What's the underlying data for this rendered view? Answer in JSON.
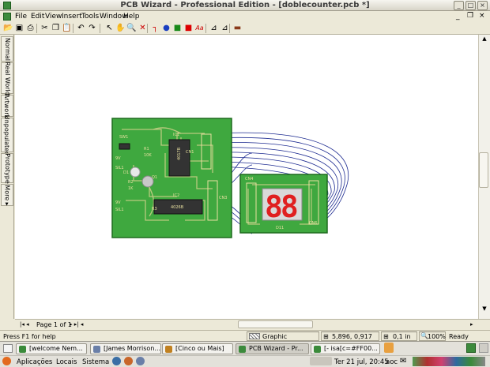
{
  "window": {
    "title": "PCB Wizard - Professional Edition - [doblecounter.pcb *]"
  },
  "menus": [
    "File",
    "Edit",
    "View",
    "Insert",
    "Tools",
    "Window",
    "Help"
  ],
  "toolbar": [
    {
      "icon": "open-folder-icon",
      "glyph": "📂"
    },
    {
      "icon": "save-icon",
      "glyph": "▣"
    },
    {
      "icon": "print-icon",
      "glyph": "⎙"
    },
    {
      "icon": "cut-icon",
      "glyph": "✂"
    },
    {
      "icon": "copy-icon",
      "glyph": "❐"
    },
    {
      "icon": "paste-icon",
      "glyph": "📋"
    },
    {
      "icon": "undo-icon",
      "glyph": "↶"
    },
    {
      "icon": "redo-icon",
      "glyph": "↷"
    },
    {
      "icon": "select-pointer-icon",
      "glyph": "↖"
    },
    {
      "icon": "hand-pan-icon",
      "glyph": "✋"
    },
    {
      "icon": "zoom-icon",
      "glyph": "🔍"
    },
    {
      "icon": "delete-icon",
      "glyph": "✕"
    },
    {
      "icon": "track-tool-icon",
      "glyph": "┐"
    },
    {
      "icon": "pad-tool-icon",
      "glyph": "●"
    },
    {
      "icon": "square-pad-icon",
      "glyph": "■"
    },
    {
      "icon": "copper-area-icon",
      "glyph": "■"
    },
    {
      "icon": "text-tool-icon",
      "glyph": "Aa"
    },
    {
      "icon": "dimension-icon",
      "glyph": "⊿"
    },
    {
      "icon": "dimension2-icon",
      "glyph": "⊿"
    },
    {
      "icon": "component-icon",
      "glyph": "▬"
    }
  ],
  "side_tabs": [
    "Normal",
    "Real World",
    "Artwork",
    "Unpopulated",
    "Prototype",
    "More ▸"
  ],
  "page_nav": {
    "label": "Page 1 of 1"
  },
  "status": {
    "help": "Press F1 for help",
    "layer": "Graphic Foreground",
    "coords": "5,896, 0,917 in",
    "grid": "0,1 in",
    "zoom": "100%",
    "state": "Ready"
  },
  "taskbar": [
    {
      "label": "[welcome Nem...",
      "icon": "chat-icon"
    },
    {
      "label": "[James Morrison...",
      "icon": "media-icon"
    },
    {
      "label": "[Cinco ou Mais]",
      "icon": "game-icon"
    },
    {
      "label": "PCB Wizard - Pr...",
      "icon": "pcb-icon",
      "active": true
    },
    {
      "label": "[- isa[c=#FF00...",
      "icon": "chat-icon"
    }
  ],
  "panel": {
    "menus": [
      "Aplicações",
      "Locais",
      "Sistema"
    ],
    "clock": "Ter 21 jul, 20:45",
    "user": "aoc"
  },
  "pcb": {
    "board1_labels": [
      "SW1",
      "9V",
      "SIL1",
      "D1",
      "R1",
      "10K",
      "Q1",
      "IC1",
      "CN1",
      "R2",
      "1K",
      "CN3",
      "IC2",
      "9V",
      "SIL1",
      "4026B",
      "R3",
      "4017B"
    ],
    "board2_labels": [
      "CN4",
      "D11",
      "CN6"
    ],
    "display_text": "88",
    "colors": {
      "board": "#3fa83f",
      "border": "#1f6a1f",
      "silk": "#e8e0a0",
      "segment": "#e02020",
      "wire": "#1c2a90"
    }
  }
}
